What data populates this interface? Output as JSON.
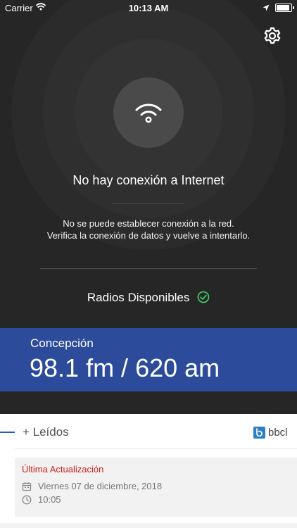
{
  "status_bar": {
    "carrier": "Carrier",
    "time": "10:13 AM"
  },
  "offline": {
    "title": "No hay conexión a Internet",
    "message_line1": "No se puede establecer conexión a la red.",
    "message_line2": "Verifica la conexión de datos y vuelve a intentarlo."
  },
  "radios": {
    "label": "Radios Disponibles",
    "status_color": "#3cc35a"
  },
  "station": {
    "city": "Concepción",
    "frequency": "98.1 fm / 620 am",
    "band_color": "#2c4b9b"
  },
  "section": {
    "title": "+ Leídos",
    "brand": "bbcl"
  },
  "update": {
    "label": "Última Actualización",
    "date": "Viernes 07 de diciembre, 2018",
    "time": "10:05"
  },
  "icons": {
    "settings": "gear-icon",
    "wifi": "wifi-icon",
    "check": "check-circle-icon",
    "calendar": "calendar-icon",
    "clock": "clock-icon"
  }
}
